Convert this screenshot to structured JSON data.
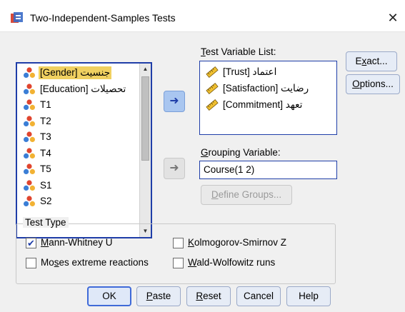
{
  "window": {
    "title": "Two-Independent-Samples Tests",
    "close_glyph": "✕"
  },
  "source_variables": [
    {
      "label": "[Gender] جنسيت",
      "icon": "nominal-variable-icon",
      "selected": true
    },
    {
      "label": "[Education] تحصيلات",
      "icon": "nominal-variable-icon",
      "selected": false
    },
    {
      "label": "T1",
      "icon": "nominal-variable-icon",
      "selected": false
    },
    {
      "label": "T2",
      "icon": "nominal-variable-icon",
      "selected": false
    },
    {
      "label": "T3",
      "icon": "nominal-variable-icon",
      "selected": false
    },
    {
      "label": "T4",
      "icon": "nominal-variable-icon",
      "selected": false
    },
    {
      "label": "T5",
      "icon": "nominal-variable-icon",
      "selected": false
    },
    {
      "label": "S1",
      "icon": "nominal-variable-icon",
      "selected": false
    },
    {
      "label": "S2",
      "icon": "nominal-variable-icon",
      "selected": false
    }
  ],
  "test_variable_list": {
    "label_prefix": "",
    "label_mnemonic": "T",
    "label_rest": "est Variable List:",
    "items": [
      {
        "label": "[Trust] اعتماد",
        "icon": "scale-variable-icon"
      },
      {
        "label": "[Satisfaction] رضايت",
        "icon": "scale-variable-icon"
      },
      {
        "label": "[Commitment] تعهد",
        "icon": "scale-variable-icon"
      }
    ]
  },
  "grouping_variable": {
    "label_mnemonic": "G",
    "label_rest": "rouping Variable:",
    "value": "Course(1 2)"
  },
  "buttons": {
    "exact": {
      "pre": "E",
      "mn": "x",
      "post": "act..."
    },
    "options": {
      "pre": "",
      "mn": "O",
      "post": "ptions..."
    },
    "define_groups": {
      "pre": "",
      "mn": "D",
      "post": "efine Groups..."
    },
    "ok": "OK",
    "paste": {
      "pre": "",
      "mn": "P",
      "post": "aste"
    },
    "reset": {
      "pre": "",
      "mn": "R",
      "post": "eset"
    },
    "cancel": "Cancel",
    "help": "Help"
  },
  "test_type": {
    "title": "Test Type",
    "options": [
      {
        "pre": "",
        "mn": "M",
        "post": "ann-Whitney U",
        "checked": true
      },
      {
        "pre": "",
        "mn": "K",
        "post": "olmogorov-Smirnov Z",
        "checked": false
      },
      {
        "pre": "Mo",
        "mn": "s",
        "post": "es extreme reactions",
        "checked": false
      },
      {
        "pre": "",
        "mn": "W",
        "post": "ald-Wolfowitz runs",
        "checked": false
      }
    ]
  },
  "colors": {
    "accent": "#1f3ea8",
    "selection": "#f0d060",
    "move_active": "#a9c6f0"
  }
}
